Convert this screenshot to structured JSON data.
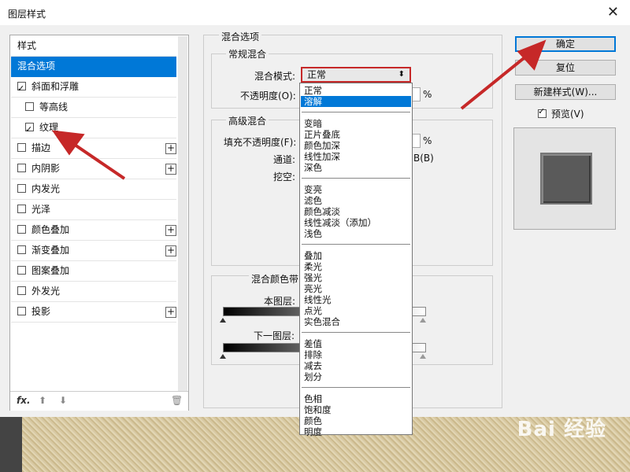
{
  "dialog": {
    "title": "图层样式"
  },
  "left_panel": {
    "items": [
      {
        "label": "样式",
        "checkbox": false,
        "checked": false,
        "plus": false,
        "selected": false,
        "indent": false
      },
      {
        "label": "混合选项",
        "checkbox": false,
        "checked": false,
        "plus": false,
        "selected": true,
        "indent": false
      },
      {
        "label": "斜面和浮雕",
        "checkbox": true,
        "checked": true,
        "plus": false,
        "selected": false,
        "indent": false
      },
      {
        "label": "等高线",
        "checkbox": true,
        "checked": false,
        "plus": false,
        "selected": false,
        "indent": true
      },
      {
        "label": "纹理",
        "checkbox": true,
        "checked": true,
        "plus": false,
        "selected": false,
        "indent": true
      },
      {
        "label": "描边",
        "checkbox": true,
        "checked": false,
        "plus": true,
        "selected": false,
        "indent": false
      },
      {
        "label": "内阴影",
        "checkbox": true,
        "checked": false,
        "plus": true,
        "selected": false,
        "indent": false
      },
      {
        "label": "内发光",
        "checkbox": true,
        "checked": false,
        "plus": false,
        "selected": false,
        "indent": false
      },
      {
        "label": "光泽",
        "checkbox": true,
        "checked": false,
        "plus": false,
        "selected": false,
        "indent": false
      },
      {
        "label": "颜色叠加",
        "checkbox": true,
        "checked": false,
        "plus": true,
        "selected": false,
        "indent": false
      },
      {
        "label": "渐变叠加",
        "checkbox": true,
        "checked": false,
        "plus": true,
        "selected": false,
        "indent": false
      },
      {
        "label": "图案叠加",
        "checkbox": true,
        "checked": false,
        "plus": false,
        "selected": false,
        "indent": false
      },
      {
        "label": "外发光",
        "checkbox": true,
        "checked": false,
        "plus": false,
        "selected": false,
        "indent": false
      },
      {
        "label": "投影",
        "checkbox": true,
        "checked": false,
        "plus": true,
        "selected": false,
        "indent": false
      }
    ],
    "footer": {
      "fx_label": "fx."
    }
  },
  "blend_options": {
    "title": "混合选项",
    "general": {
      "title": "常规混合",
      "mode_label": "混合模式:",
      "mode_value": "正常",
      "opacity_label": "不透明度(O):",
      "opacity_unit": "%"
    },
    "advanced": {
      "title": "高级混合",
      "fill_label": "填充不透明度(F):",
      "fill_unit": "%",
      "channels_label": "通道:",
      "channels_partial": "B(B)",
      "knockout_label": "挖空:"
    },
    "blend_if": {
      "title": "混合颜色带:",
      "this_layer": "本图层:",
      "underlying_layer": "下一图层:"
    }
  },
  "blend_dropdown": {
    "groups": [
      [
        "正常",
        "溶解"
      ],
      [
        "变暗",
        "正片叠底",
        "颜色加深",
        "线性加深",
        "深色"
      ],
      [
        "变亮",
        "滤色",
        "颜色减淡",
        "线性减淡（添加）",
        "浅色"
      ],
      [
        "叠加",
        "柔光",
        "强光",
        "亮光",
        "线性光",
        "点光",
        "实色混合"
      ],
      [
        "差值",
        "排除",
        "减去",
        "划分"
      ],
      [
        "色相",
        "饱和度",
        "颜色",
        "明度"
      ]
    ],
    "highlighted": "溶解"
  },
  "buttons": {
    "ok": "确定",
    "reset": "复位",
    "new_style": "新建样式(W)...",
    "preview_label": "预览(V)",
    "preview_checked": true
  },
  "watermark": "Bai 经验",
  "colors": {
    "accent": "#0078d7",
    "highlight_border": "#c62828",
    "annotation_arrow": "#c62828"
  }
}
